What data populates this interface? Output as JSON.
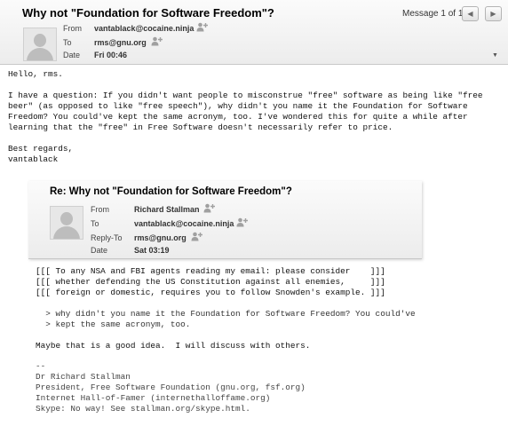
{
  "message": {
    "subject": "Why not \"Foundation for Software Freedom\"?",
    "count": "Message 1 of 1",
    "from_label": "From",
    "from": "vantablack@cocaine.ninja",
    "to_label": "To",
    "to": "rms@gnu.org",
    "date_label": "Date",
    "date": "Fri 00:46",
    "body_lines": [
      "Hello, rms.",
      "",
      "I have a question: If you didn't want people to misconstrue \"free\" software as being like \"free",
      "beer\" (as opposed to like \"free speech\"), why didn't you name it the Foundation for Software",
      "Freedom? You could've kept the same acronym, too. I've wondered this for quite a while after",
      "learning that the \"free\" in Free Software doesn't necessarily refer to price.",
      "",
      "Best regards,",
      "vantablack"
    ]
  },
  "reply": {
    "subject": "Re: Why not \"Foundation for Software Freedom\"?",
    "from_label": "From",
    "from": "Richard Stallman",
    "to_label": "To",
    "to": "vantablack@cocaine.ninja",
    "replyto_label": "Reply-To",
    "replyto": "rms@gnu.org",
    "date_label": "Date",
    "date": "Sat 03:19",
    "notice_lines": [
      "[[[ To any NSA and FBI agents reading my email: please consider    ]]]",
      "[[[ whether defending the US Constitution against all enemies,     ]]]",
      "[[[ foreign or domestic, requires you to follow Snowden's example. ]]]"
    ],
    "quoted_lines": [
      "  > why didn't you name it the Foundation for Software Freedom? You could've",
      "  > kept the same acronym, too."
    ],
    "response": "Maybe that is a good idea.  I will discuss with others.",
    "signature_lines": [
      "--",
      "Dr Richard Stallman",
      "President, Free Software Foundation (gnu.org, fsf.org)",
      "Internet Hall-of-Famer (internethalloffame.org)",
      "Skype: No way! See stallman.org/skype.html."
    ]
  },
  "icons": {
    "avatar": "person-silhouette-icon",
    "add_contact": "add-contact-icon",
    "prev": "triangle-left-icon",
    "next": "triangle-right-icon",
    "more": "triangle-down-icon"
  }
}
